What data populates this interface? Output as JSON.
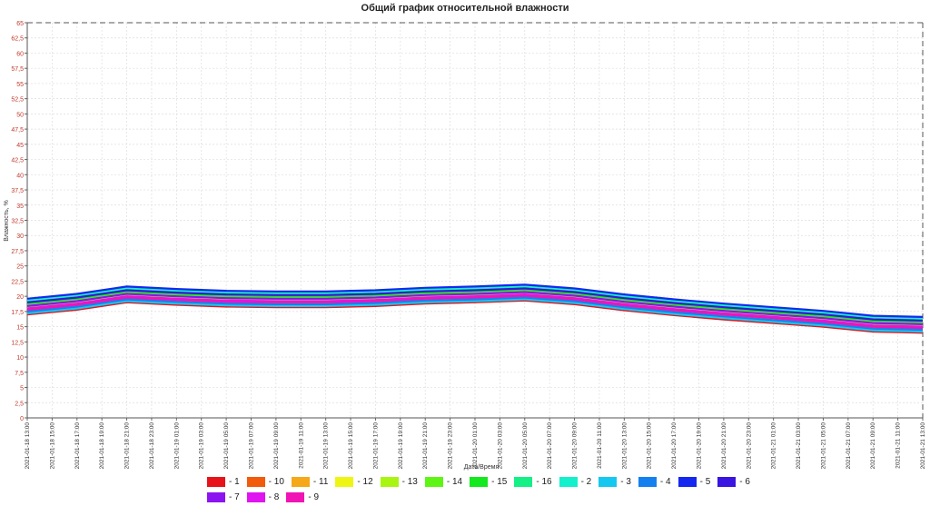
{
  "chart_data": {
    "type": "line",
    "title": "Общий график относительной влажности",
    "xlabel": "Дата/Время",
    "ylabel": "Влажность, %",
    "ylim": [
      0,
      65
    ],
    "y_ticks": [
      "0",
      "2,5",
      "5",
      "7,5",
      "10",
      "12,5",
      "15",
      "17,5",
      "20",
      "22,5",
      "25",
      "27,5",
      "30",
      "32,5",
      "35",
      "37,5",
      "40",
      "42,5",
      "45",
      "47,5",
      "50",
      "52,5",
      "55",
      "57,5",
      "60",
      "62,5",
      "65"
    ],
    "x_ticks": [
      "2021-01-18 13:00",
      "2021-01-18 15:00",
      "2021-01-18 17:00",
      "2021-01-18 19:00",
      "2021-01-18 21:00",
      "2021-01-18 23:00",
      "2021-01-19 01:00",
      "2021-01-19 03:00",
      "2021-01-19 05:00",
      "2021-01-19 07:00",
      "2021-01-19 09:00",
      "2021-01-19 11:00",
      "2021-01-19 13:00",
      "2021-01-19 15:00",
      "2021-01-19 17:00",
      "2021-01-19 19:00",
      "2021-01-19 21:00",
      "2021-01-19 23:00",
      "2021-01-20 01:00",
      "2021-01-20 03:00",
      "2021-01-20 05:00",
      "2021-01-20 07:00",
      "2021-01-20 09:00",
      "2021-01-20 11:00",
      "2021-01-20 13:00",
      "2021-01-20 15:00",
      "2021-01-20 17:00",
      "2021-01-20 19:00",
      "2021-01-20 21:00",
      "2021-01-20 23:00",
      "2021-01-21 01:00",
      "2021-01-21 03:00",
      "2021-01-21 05:00",
      "2021-01-21 07:00",
      "2021-01-21 09:00",
      "2021-01-21 11:00",
      "2021-01-21 13:00"
    ],
    "x": [
      "2021-01-18 13:00",
      "2021-01-18 17:00",
      "2021-01-18 21:00",
      "2021-01-19 01:00",
      "2021-01-19 05:00",
      "2021-01-19 09:00",
      "2021-01-19 13:00",
      "2021-01-19 17:00",
      "2021-01-19 21:00",
      "2021-01-20 01:00",
      "2021-01-20 05:00",
      "2021-01-20 09:00",
      "2021-01-20 13:00",
      "2021-01-20 17:00",
      "2021-01-20 21:00",
      "2021-01-21 01:00",
      "2021-01-21 05:00",
      "2021-01-21 09:00",
      "2021-01-21 13:00"
    ],
    "grid": true,
    "legend_position": "bottom",
    "series": [
      {
        "name": "1",
        "color": "#e8121a",
        "values": [
          17.0,
          17.8,
          19.0,
          18.6,
          18.3,
          18.2,
          18.2,
          18.4,
          18.8,
          19.0,
          19.3,
          18.7,
          17.7,
          16.9,
          16.2,
          15.6,
          15.0,
          14.2,
          14.0
        ]
      },
      {
        "name": "10",
        "color": "#f25a0c",
        "values": [
          17.3,
          18.1,
          19.3,
          18.9,
          18.6,
          18.5,
          18.5,
          18.7,
          19.1,
          19.3,
          19.6,
          19.0,
          18.0,
          17.2,
          16.5,
          15.9,
          15.3,
          14.5,
          14.3
        ]
      },
      {
        "name": "11",
        "color": "#f5a818",
        "values": [
          17.6,
          18.4,
          19.6,
          19.2,
          18.9,
          18.8,
          18.8,
          19.0,
          19.4,
          19.6,
          19.9,
          19.3,
          18.3,
          17.5,
          16.8,
          16.2,
          15.6,
          14.8,
          14.6
        ]
      },
      {
        "name": "12",
        "color": "#eef515",
        "values": [
          17.9,
          18.7,
          19.9,
          19.5,
          19.2,
          19.1,
          19.1,
          19.3,
          19.7,
          19.9,
          20.2,
          19.6,
          18.6,
          17.8,
          17.1,
          16.5,
          15.9,
          15.1,
          14.9
        ]
      },
      {
        "name": "13",
        "color": "#a8f512",
        "values": [
          18.2,
          19.0,
          20.2,
          19.8,
          19.5,
          19.4,
          19.4,
          19.6,
          20.0,
          20.2,
          20.5,
          19.9,
          18.9,
          18.1,
          17.4,
          16.8,
          16.2,
          15.4,
          15.2
        ]
      },
      {
        "name": "14",
        "color": "#5ef514",
        "values": [
          18.5,
          19.3,
          20.5,
          20.1,
          19.8,
          19.7,
          19.7,
          19.9,
          20.3,
          20.5,
          20.8,
          20.2,
          19.2,
          18.4,
          17.7,
          17.1,
          16.5,
          15.7,
          15.5
        ]
      },
      {
        "name": "15",
        "color": "#14e81e",
        "values": [
          18.8,
          19.6,
          20.8,
          20.4,
          20.1,
          20.0,
          20.0,
          20.2,
          20.6,
          20.8,
          21.1,
          20.5,
          19.5,
          18.7,
          18.0,
          17.4,
          16.8,
          16.0,
          15.8
        ]
      },
      {
        "name": "16",
        "color": "#14f085",
        "values": [
          19.1,
          19.9,
          21.1,
          20.7,
          20.4,
          20.3,
          20.3,
          20.5,
          20.9,
          21.1,
          21.4,
          20.8,
          19.8,
          19.0,
          18.3,
          17.7,
          17.1,
          16.3,
          16.1
        ]
      },
      {
        "name": "2",
        "color": "#14f0cc",
        "values": [
          19.4,
          20.2,
          21.4,
          21.0,
          20.7,
          20.6,
          20.6,
          20.8,
          21.2,
          21.4,
          21.7,
          21.1,
          20.1,
          19.3,
          18.6,
          18.0,
          17.4,
          16.6,
          16.4
        ]
      },
      {
        "name": "3",
        "color": "#14c8f0",
        "values": [
          17.2,
          18.0,
          19.2,
          18.8,
          18.5,
          18.4,
          18.4,
          18.6,
          19.0,
          19.2,
          19.5,
          18.9,
          17.9,
          17.1,
          16.4,
          15.8,
          15.2,
          14.4,
          14.2
        ]
      },
      {
        "name": "4",
        "color": "#1480f0",
        "values": [
          17.5,
          18.3,
          19.5,
          19.1,
          18.8,
          18.7,
          18.7,
          18.9,
          19.3,
          19.5,
          19.8,
          19.2,
          18.2,
          17.4,
          16.7,
          16.1,
          15.5,
          14.7,
          14.5
        ]
      },
      {
        "name": "5",
        "color": "#1428f0",
        "values": [
          19.6,
          20.4,
          21.6,
          21.2,
          20.9,
          20.8,
          20.8,
          21.0,
          21.4,
          21.6,
          21.9,
          21.3,
          20.3,
          19.5,
          18.8,
          18.2,
          17.6,
          16.8,
          16.6
        ]
      },
      {
        "name": "6",
        "color": "#3a14e0",
        "values": [
          19.0,
          19.8,
          21.0,
          20.6,
          20.3,
          20.2,
          20.2,
          20.4,
          20.8,
          21.0,
          21.3,
          20.7,
          19.7,
          18.9,
          18.2,
          17.6,
          17.0,
          16.2,
          16.0
        ]
      },
      {
        "name": "7",
        "color": "#8c14f0",
        "values": [
          18.4,
          19.2,
          20.4,
          20.0,
          19.7,
          19.6,
          19.6,
          19.8,
          20.2,
          20.4,
          20.7,
          20.1,
          19.1,
          18.3,
          17.6,
          17.0,
          16.4,
          15.6,
          15.4
        ]
      },
      {
        "name": "8",
        "color": "#e014f0",
        "values": [
          18.0,
          18.8,
          20.0,
          19.6,
          19.3,
          19.2,
          19.2,
          19.4,
          19.8,
          20.0,
          20.3,
          19.7,
          18.7,
          17.9,
          17.2,
          16.6,
          16.0,
          15.2,
          15.0
        ]
      },
      {
        "name": "9",
        "color": "#f014b4",
        "values": [
          17.8,
          18.6,
          19.8,
          19.4,
          19.1,
          19.0,
          19.0,
          19.2,
          19.6,
          19.8,
          20.1,
          19.5,
          18.5,
          17.7,
          17.0,
          16.4,
          15.8,
          15.0,
          14.8
        ]
      }
    ]
  }
}
